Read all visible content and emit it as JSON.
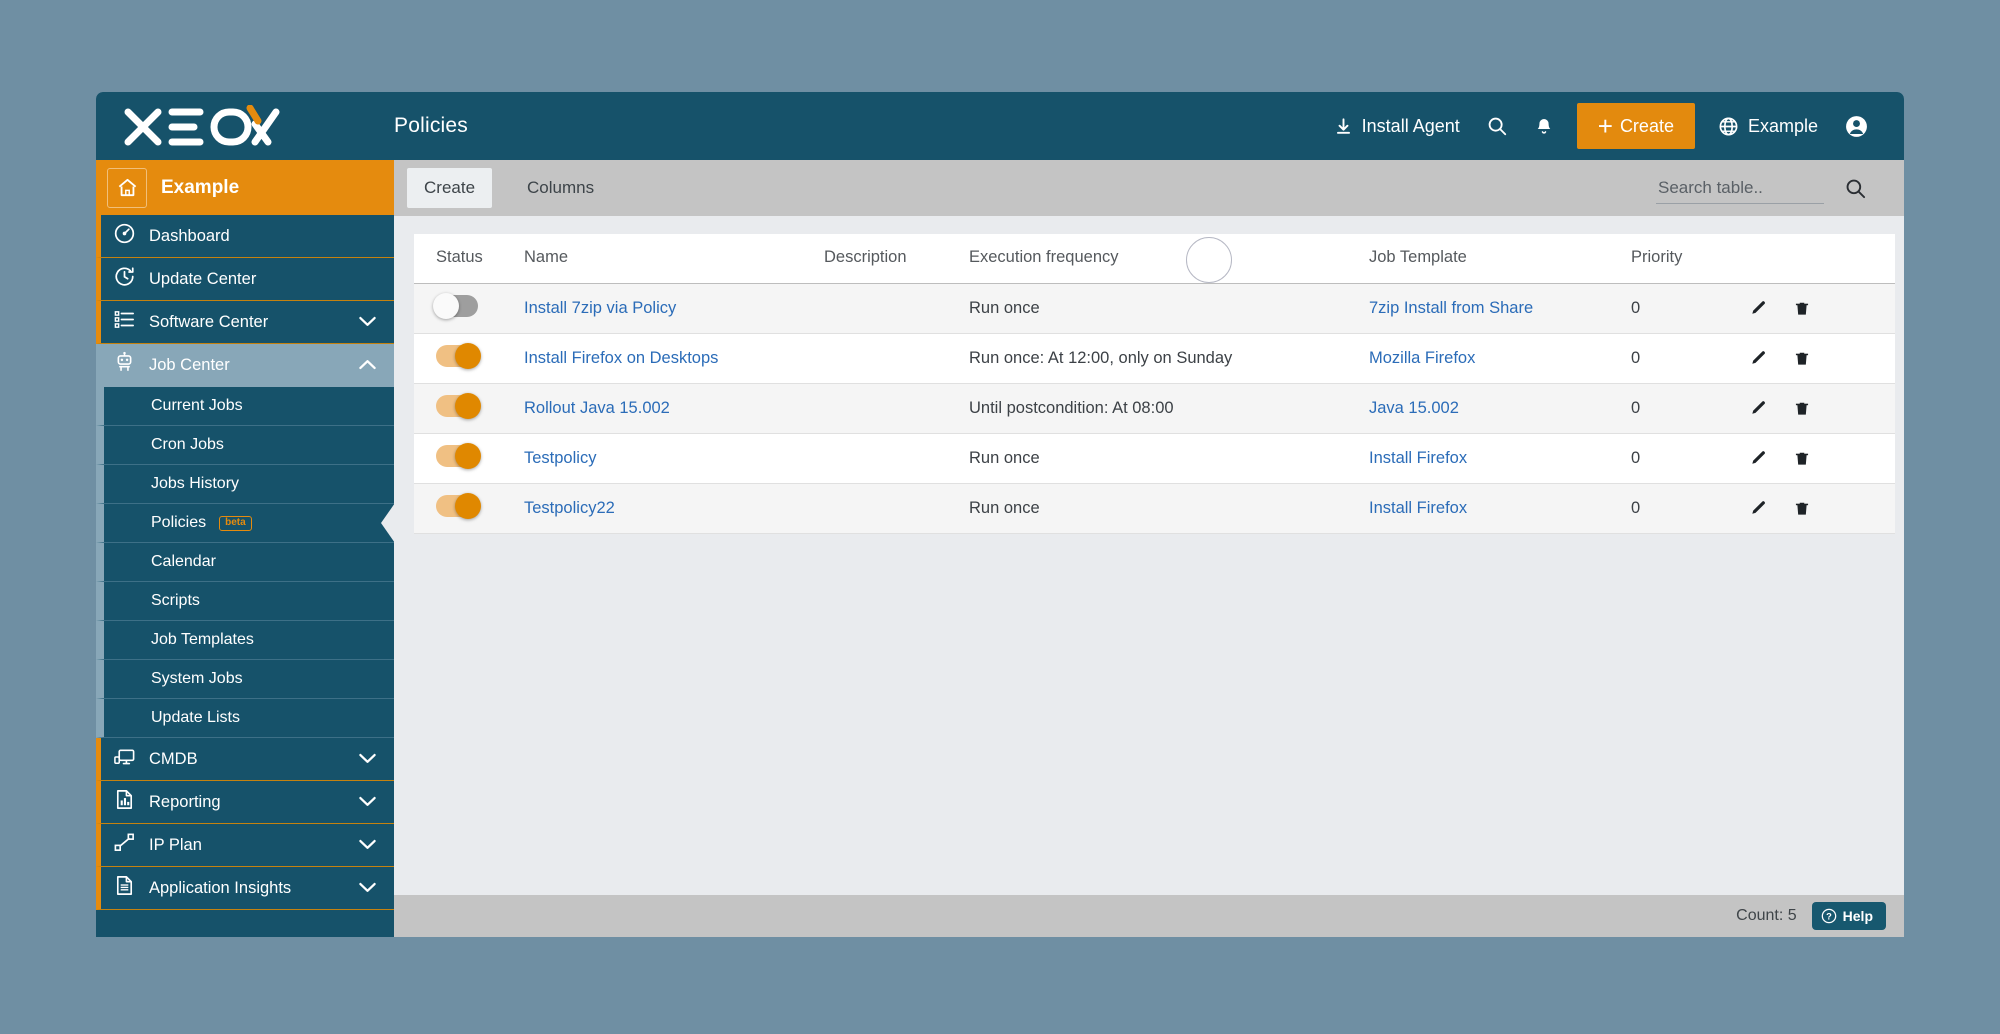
{
  "brand": {
    "logo_text": "XEOX",
    "accent_color": "#e58b0e",
    "primary_color": "#16526a"
  },
  "topbar": {
    "page_title": "Policies",
    "install_agent_label": "Install Agent",
    "search_icon": "search-icon",
    "bell_icon": "bell-icon",
    "create_label": "Create",
    "tenant_label": "Example",
    "globe_icon": "globe-icon",
    "account_icon": "account-circle-icon"
  },
  "sidebar": {
    "tenant": {
      "label": "Example",
      "icon": "home-icon"
    },
    "groups": [
      {
        "label": "Dashboard",
        "icon": "gauge-icon",
        "expandable": false,
        "expanded": false,
        "active": false
      },
      {
        "label": "Update Center",
        "icon": "clock-refresh-icon",
        "expandable": false,
        "expanded": false,
        "active": false
      },
      {
        "label": "Software Center",
        "icon": "list-icon",
        "expandable": true,
        "expanded": false,
        "active": false
      },
      {
        "label": "Job Center",
        "icon": "robot-icon",
        "expandable": true,
        "expanded": true,
        "active": true
      }
    ],
    "sub_items": [
      {
        "label": "Current Jobs",
        "badge": null,
        "active": false
      },
      {
        "label": "Cron Jobs",
        "badge": null,
        "active": false
      },
      {
        "label": "Jobs History",
        "badge": null,
        "active": false
      },
      {
        "label": "Policies",
        "badge": "beta",
        "active": true
      },
      {
        "label": "Calendar",
        "badge": null,
        "active": false
      },
      {
        "label": "Scripts",
        "badge": null,
        "active": false
      },
      {
        "label": "Job Templates",
        "badge": null,
        "active": false
      },
      {
        "label": "System Jobs",
        "badge": null,
        "active": false
      },
      {
        "label": "Update Lists",
        "badge": null,
        "active": false
      }
    ],
    "groups_bottom": [
      {
        "label": "CMDB",
        "icon": "monitor-icon",
        "expandable": true,
        "expanded": false
      },
      {
        "label": "Reporting",
        "icon": "chart-doc-icon",
        "expandable": true,
        "expanded": false
      },
      {
        "label": "IP Plan",
        "icon": "network-icon",
        "expandable": true,
        "expanded": false
      },
      {
        "label": "Application Insights",
        "icon": "document-icon",
        "expandable": true,
        "expanded": false
      }
    ]
  },
  "toolbar": {
    "create_label": "Create",
    "columns_label": "Columns",
    "search_placeholder": "Search table..",
    "search_value": "",
    "search_icon": "search-icon"
  },
  "table": {
    "columns": [
      "Status",
      "Name",
      "Description",
      "Execution frequency",
      "Job Template",
      "Priority",
      ""
    ],
    "rows": [
      {
        "status": false,
        "name": "Install 7zip via Policy",
        "description": "",
        "frequency": "Run once",
        "job_template": "7zip Install from Share",
        "priority": "0",
        "edit_icon": "pencil-icon",
        "delete_icon": "trash-icon"
      },
      {
        "status": true,
        "name": "Install Firefox on Desktops",
        "description": "",
        "frequency": "Run once: At 12:00, only on Sunday",
        "job_template": "Mozilla Firefox",
        "priority": "0",
        "edit_icon": "pencil-icon",
        "delete_icon": "trash-icon"
      },
      {
        "status": true,
        "name": "Rollout Java 15.002",
        "description": "",
        "frequency": "Until postcondition: At 08:00",
        "job_template": "Java 15.002",
        "priority": "0",
        "edit_icon": "pencil-icon",
        "delete_icon": "trash-icon"
      },
      {
        "status": true,
        "name": "Testpolicy",
        "description": "",
        "frequency": "Run once",
        "job_template": "Install Firefox",
        "priority": "0",
        "edit_icon": "pencil-icon",
        "delete_icon": "trash-icon"
      },
      {
        "status": true,
        "name": "Testpolicy22",
        "description": "",
        "frequency": "Run once",
        "job_template": "Install Firefox",
        "priority": "0",
        "edit_icon": "pencil-icon",
        "delete_icon": "trash-icon"
      }
    ],
    "loading_indicator": "spinner-ring"
  },
  "footer": {
    "count_label": "Count: 5",
    "help_label": "Help",
    "help_icon": "question-circle-icon"
  }
}
